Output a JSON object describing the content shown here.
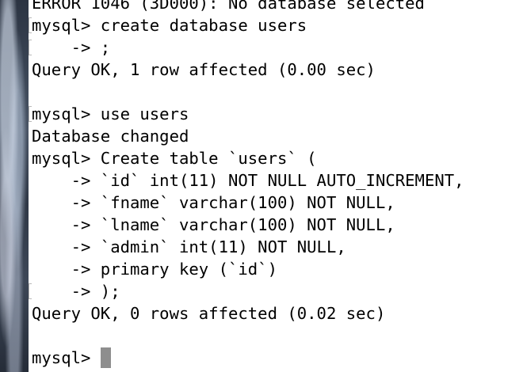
{
  "terminal": {
    "lines": [
      "ERROR 1046 (3D000): No database selected",
      "mysql> create database users",
      "    -> ;",
      "Query OK, 1 row affected (0.00 sec)",
      "",
      "mysql> use users",
      "Database changed",
      "mysql> Create table `users` (",
      "    -> `id` int(11) NOT NULL AUTO_INCREMENT,",
      "    -> `fname` varchar(100) NOT NULL,",
      "    -> `lname` varchar(100) NOT NULL,",
      "    -> `admin` int(11) NOT NULL,",
      "    -> primary key (`id`)",
      "    -> );",
      "Query OK, 0 rows affected (0.02 sec)",
      "",
      "mysql> "
    ]
  },
  "colors": {
    "background": "#ffffff",
    "text": "#000000",
    "cursor": "#8e8e8e"
  }
}
